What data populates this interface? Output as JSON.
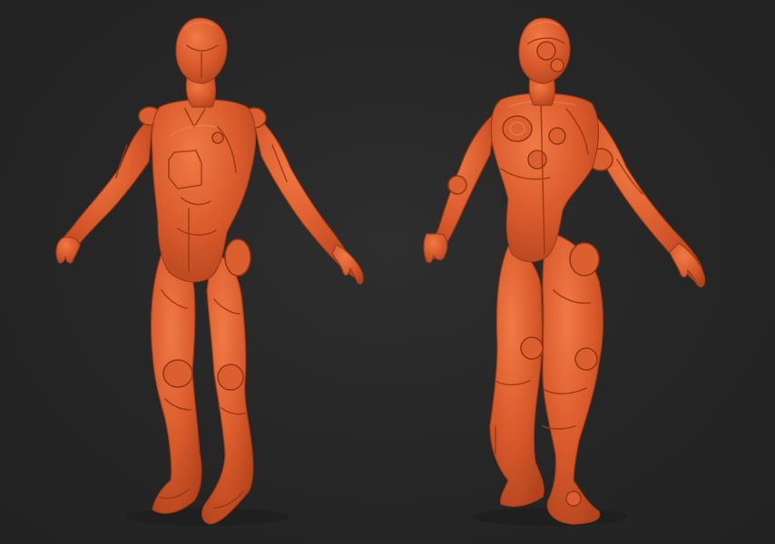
{
  "scene": {
    "background_color": "#262626",
    "material_color": "#d95a2c",
    "figures": [
      {
        "view": "front"
      },
      {
        "view": "back"
      }
    ]
  }
}
